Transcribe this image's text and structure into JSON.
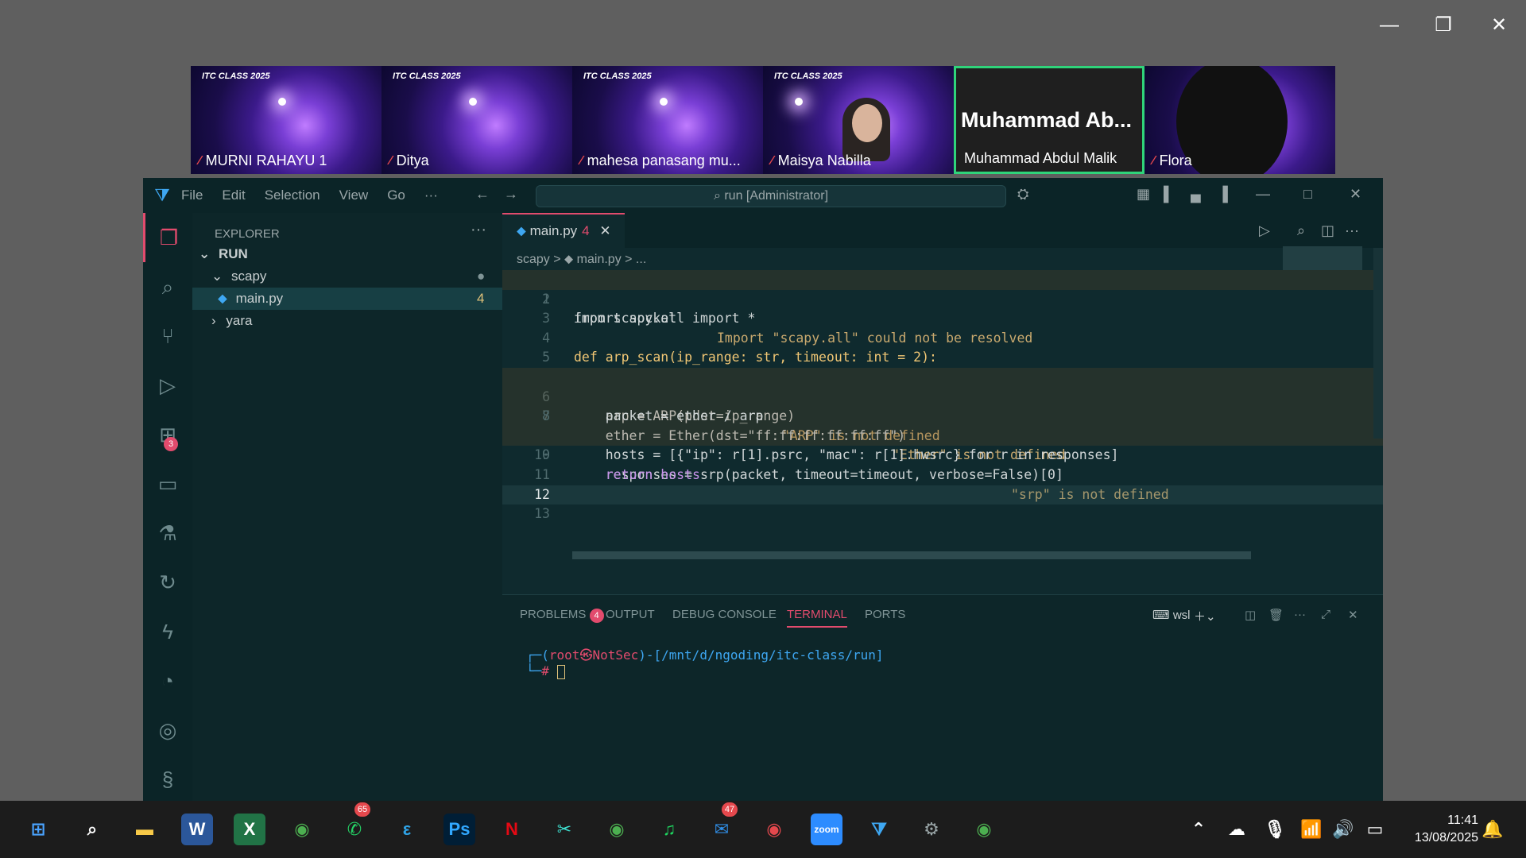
{
  "participants": [
    {
      "brand": "ITC CLASS 2025",
      "name": "MURNI RAHAYU 1",
      "muted": true
    },
    {
      "brand": "ITC CLASS 2025",
      "name": "Ditya",
      "muted": true
    },
    {
      "brand": "ITC CLASS 2025",
      "name": "mahesa panasang mu...",
      "muted": true
    },
    {
      "brand": "ITC CLASS 2025",
      "name": "Maisya Nabilla",
      "muted": true
    },
    {
      "big_name": "Muhammad  Ab...",
      "name": "Muhammad Abdul Malik",
      "muted": false
    },
    {
      "brand": "ITC CLASS 2025",
      "name": "Flora",
      "muted": true
    }
  ],
  "window_controls": {
    "minimize": "—",
    "restore": "❐",
    "close": "✕"
  },
  "vscode": {
    "menu": [
      "File",
      "Edit",
      "Selection",
      "View",
      "Go",
      "···"
    ],
    "command_center": "⌕ run [Administrator]",
    "explorer": {
      "title": "EXPLORER",
      "more": "···",
      "root": "RUN",
      "folder": "scapy",
      "file": "main.py",
      "file_errors": "4",
      "other_folder": "yara"
    },
    "activity_badge": "3",
    "tab": {
      "label": "main.py",
      "errors": "4",
      "close": "✕"
    },
    "breadcrumbs": "scapy  >  ⬥ main.py  >  ...",
    "code": [
      {
        "n": "1",
        "text": "from scapy.all import *",
        "diag": "Import \"scapy.all\" could not be resolved"
      },
      {
        "n": "2",
        "text": "",
        "diag": ""
      },
      {
        "n": "3",
        "text": "import socket",
        "diag": ""
      },
      {
        "n": "4",
        "text": "",
        "diag": ""
      },
      {
        "n": "5",
        "text": "def arp_scan(ip_range: str, timeout: int = 2):",
        "diag": ""
      },
      {
        "n": "6",
        "text": "    arp = ARP(pdst=ip_range)",
        "diag": "\"ARP\" is not defined"
      },
      {
        "n": "7",
        "text": "    ether = Ether(dst=\"ff:ff:ff:ff:ff:ff\")",
        "diag": "\"Ether\" is not defined"
      },
      {
        "n": "8",
        "text": "    packet = ether / arp",
        "diag": ""
      },
      {
        "n": "9",
        "text": "    responses = srp(packet, timeout=timeout, verbose=False)[0]",
        "diag": "\"srp\" is not defined"
      },
      {
        "n": "10",
        "text": "    hosts = [{\"ip\": r[1].psrc, \"mac\": r[1].hwsrc} for r in responses]",
        "diag": ""
      },
      {
        "n": "11",
        "text": "    return hosts",
        "diag": ""
      },
      {
        "n": "12",
        "text": "",
        "diag": ""
      },
      {
        "n": "13",
        "text": "",
        "diag": ""
      }
    ],
    "panel_tabs": {
      "problems": "PROBLEMS",
      "problems_count": "4",
      "output": "OUTPUT",
      "debug": "DEBUG CONSOLE",
      "terminal": "TERMINAL",
      "ports": "PORTS"
    },
    "terminal_shell": "wsl",
    "terminal_prompt_user": "root㉿NotSec",
    "terminal_prompt_path": "[/mnt/d/ngoding/itc-class/run]",
    "terminal_prompt_hash": "#"
  },
  "taskbar": {
    "whatsapp_badge": "65",
    "mail_badge": "47",
    "time": "11:41",
    "date": "13/08/2025"
  }
}
